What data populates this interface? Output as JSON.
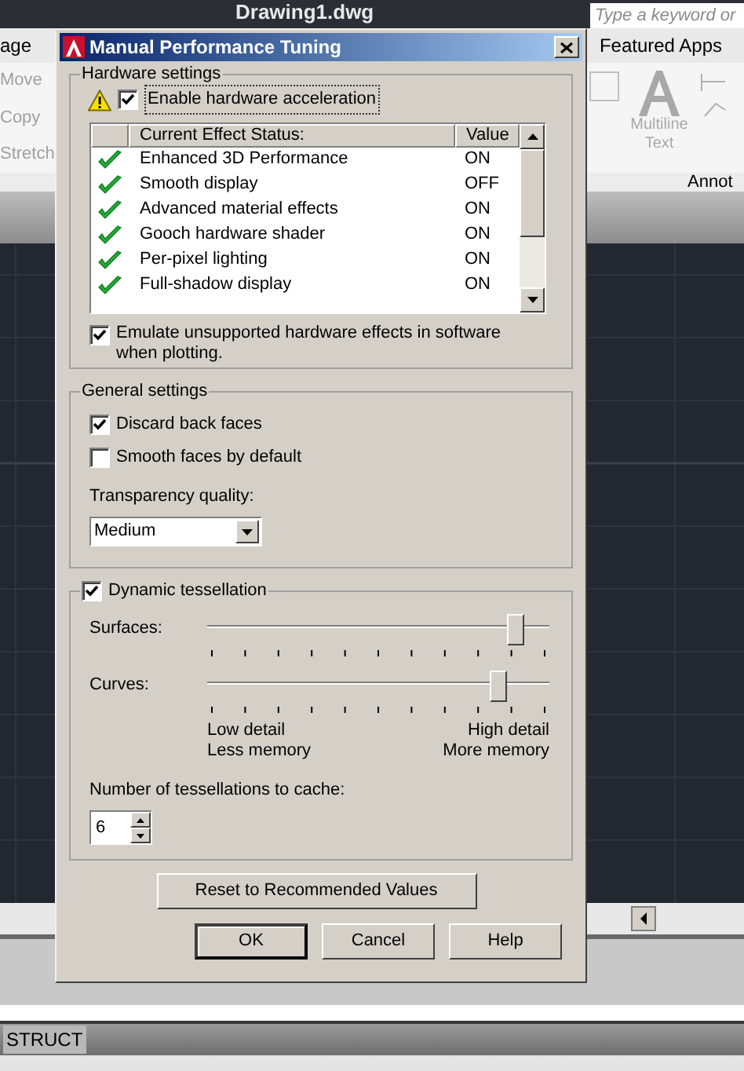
{
  "app": {
    "title": "Drawing1.dwg",
    "search": {
      "placeholder": "Type a keyword or"
    },
    "ribbon_tabs": [
      {
        "label": "age"
      },
      {
        "label": "Featured Apps"
      }
    ],
    "tools_left": [
      "Move",
      "Copy",
      "Stretch"
    ],
    "tool_right": "Multiline Text",
    "panel_label": "Annot",
    "layout_tab": "STRUCT"
  },
  "dialog": {
    "title": "Manual Performance Tuning",
    "hardware": {
      "title": "Hardware settings",
      "enable": {
        "label": "Enable hardware acceleration",
        "checked": true
      },
      "effects_table": {
        "columns": [
          "Current Effect Status:",
          "Value"
        ],
        "rows": [
          {
            "name": "Enhanced 3D Performance",
            "value": "ON"
          },
          {
            "name": "Smooth display",
            "value": "OFF"
          },
          {
            "name": "Advanced material effects",
            "value": "ON"
          },
          {
            "name": "Gooch hardware shader",
            "value": "ON"
          },
          {
            "name": "Per-pixel lighting",
            "value": "ON"
          },
          {
            "name": "Full-shadow display",
            "value": "ON"
          }
        ]
      },
      "emulate": {
        "label": "Emulate unsupported hardware effects in software when plotting.",
        "checked": true
      }
    },
    "general": {
      "title": "General settings",
      "options": [
        {
          "label": "Discard back faces",
          "checked": true
        },
        {
          "label": "Smooth faces by default",
          "checked": false
        }
      ],
      "transparency": {
        "label": "Transparency quality:",
        "value": "Medium"
      }
    },
    "tessellation": {
      "label": "Dynamic tessellation",
      "checked": true,
      "sliders": [
        {
          "label": "Surfaces:",
          "level": 0.9
        },
        {
          "label": "Curves:",
          "level": 0.85
        }
      ],
      "low_labels": [
        "Low detail",
        "Less memory"
      ],
      "high_labels": [
        "High detail",
        "More memory"
      ],
      "cache": {
        "label": "Number of tessellations to cache:",
        "value": "6"
      }
    },
    "reset_button": "Reset to Recommended Values",
    "buttons": [
      {
        "label": "OK",
        "default": true
      },
      {
        "label": "Cancel",
        "default": false
      },
      {
        "label": "Help",
        "default": false
      }
    ]
  }
}
